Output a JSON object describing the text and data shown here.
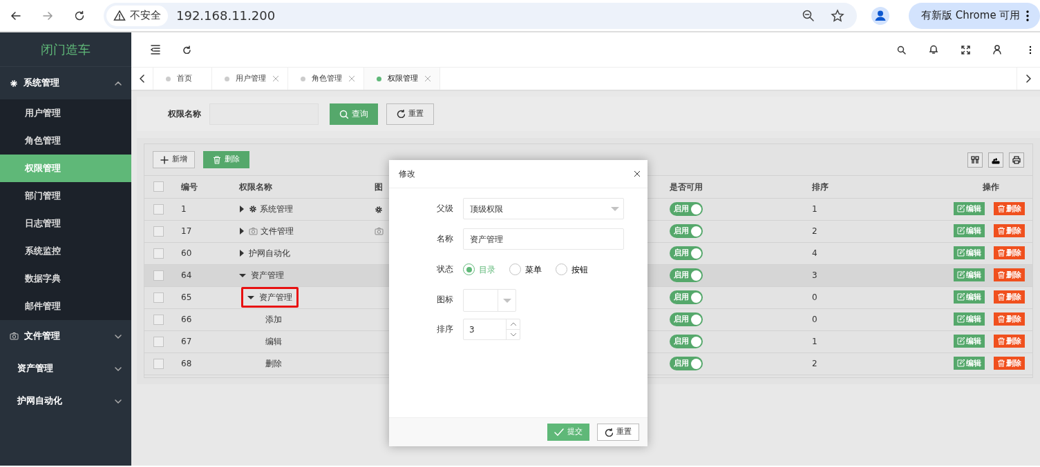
{
  "browser": {
    "security": "不安全",
    "url": "192.168.11.200",
    "update_button": "有新版 Chrome 可用"
  },
  "sidebar": {
    "logo": "闭门造车",
    "menu": [
      {
        "label": "系统管理",
        "kind": "gear",
        "expanded": true,
        "children": [
          {
            "label": "用户管理",
            "selected": false
          },
          {
            "label": "角色管理",
            "selected": false
          },
          {
            "label": "权限管理",
            "selected": true
          },
          {
            "label": "部门管理",
            "selected": false
          },
          {
            "label": "日志管理",
            "selected": false
          },
          {
            "label": "系统监控",
            "selected": false
          },
          {
            "label": "数据字典",
            "selected": false
          },
          {
            "label": "邮件管理",
            "selected": false
          }
        ]
      },
      {
        "label": "文件管理",
        "kind": "camera",
        "expanded": false
      },
      {
        "label": "资产管理",
        "expanded": false
      },
      {
        "label": "护网自动化",
        "expanded": false
      }
    ]
  },
  "tabs": [
    {
      "label": "首页",
      "closable": false,
      "selected": false
    },
    {
      "label": "用户管理",
      "closable": true,
      "selected": false
    },
    {
      "label": "角色管理",
      "closable": true,
      "selected": false
    },
    {
      "label": "权限管理",
      "closable": true,
      "selected": true
    }
  ],
  "search": {
    "label": "权限名称",
    "buttons": [
      "查询",
      "重置"
    ]
  },
  "toolbar": {
    "add": "新增",
    "delete": "删除"
  },
  "table": {
    "columns": [
      "编号",
      "权限名称",
      "图",
      "是否可用",
      "排序",
      "操作"
    ],
    "select_all": false,
    "rows": [
      {
        "id": "1",
        "name": "系统管理",
        "kind": "gear",
        "expanded": false,
        "hovered": false,
        "marked": false,
        "checked": false,
        "status": "启用",
        "enabled": true,
        "order": "1",
        "actions": [
          "编辑",
          "删除"
        ]
      },
      {
        "id": "17",
        "name": "文件管理",
        "kind": "camera",
        "expanded": false,
        "hovered": false,
        "marked": false,
        "checked": false,
        "status": "启用",
        "enabled": true,
        "order": "2",
        "actions": [
          "编辑",
          "删除"
        ]
      },
      {
        "id": "60",
        "name": "护网自动化",
        "expanded": false,
        "hovered": false,
        "marked": false,
        "checked": false,
        "status": "启用",
        "enabled": true,
        "order": "4",
        "actions": [
          "编辑",
          "删除"
        ]
      },
      {
        "id": "64",
        "name": "资产管理",
        "expanded": true,
        "hovered": true,
        "marked": false,
        "checked": false,
        "status": "启用",
        "enabled": true,
        "order": "3",
        "actions": [
          "编辑",
          "删除"
        ],
        "children": [
          {
            "id": "65",
            "name": "资产管理",
            "expanded": true,
            "hovered": false,
            "marked": true,
            "checked": false,
            "status": "启用",
            "enabled": true,
            "order": "0",
            "actions": [
              "编辑",
              "删除"
            ],
            "children": [
              {
                "id": "66",
                "name": "添加",
                "hovered": false,
                "marked": false,
                "checked": false,
                "status": "启用",
                "enabled": true,
                "order": "0",
                "actions": [
                  "编辑",
                  "删除"
                ]
              },
              {
                "id": "67",
                "name": "编辑",
                "hovered": false,
                "marked": false,
                "checked": false,
                "status": "启用",
                "enabled": true,
                "order": "1",
                "actions": [
                  "编辑",
                  "删除"
                ]
              },
              {
                "id": "68",
                "name": "删除",
                "hovered": false,
                "marked": false,
                "checked": false,
                "status": "启用",
                "enabled": true,
                "order": "2",
                "actions": [
                  "编辑",
                  "删除"
                ]
              }
            ]
          }
        ]
      }
    ]
  },
  "dialog": {
    "title": "修改",
    "fields": [
      {
        "kind": "select",
        "label": "父级",
        "value": "顶级权限"
      },
      {
        "kind": "text",
        "label": "名称",
        "value": "资产管理"
      },
      {
        "kind": "radio",
        "label": "状态",
        "options": [
          {
            "label": "目录",
            "selected": true
          },
          {
            "label": "菜单",
            "selected": false
          },
          {
            "label": "按钮",
            "selected": false
          }
        ]
      },
      {
        "kind": "iconselect",
        "label": "图标"
      },
      {
        "kind": "number",
        "label": "排序",
        "value": "3"
      }
    ],
    "buttons": [
      "提交",
      "重置"
    ]
  }
}
